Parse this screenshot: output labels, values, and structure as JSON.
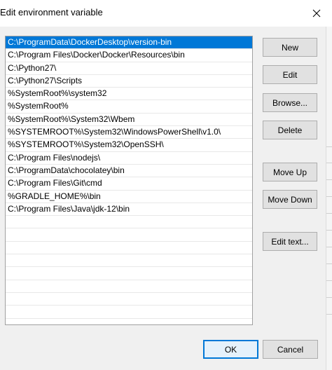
{
  "window": {
    "title": "Edit environment variable",
    "close_glyph": "✕"
  },
  "paths": [
    "C:\\ProgramData\\DockerDesktop\\version-bin",
    "C:\\Program Files\\Docker\\Docker\\Resources\\bin",
    "C:\\Python27\\",
    "C:\\Python27\\Scripts",
    "%SystemRoot%\\system32",
    "%SystemRoot%",
    "%SystemRoot%\\System32\\Wbem",
    "%SYSTEMROOT%\\System32\\WindowsPowerShell\\v1.0\\",
    "%SYSTEMROOT%\\System32\\OpenSSH\\",
    "C:\\Program Files\\nodejs\\",
    "C:\\ProgramData\\chocolatey\\bin",
    "C:\\Program Files\\Git\\cmd",
    "%GRADLE_HOME%\\bin",
    "C:\\Program Files\\Java\\jdk-12\\bin",
    "",
    "",
    "",
    "",
    "",
    "",
    "",
    ""
  ],
  "selected_index": 0,
  "buttons": {
    "new": "New",
    "edit": "Edit",
    "browse": "Browse...",
    "delete": "Delete",
    "move_up": "Move Up",
    "move_down": "Move Down",
    "edit_text": "Edit text..."
  },
  "footer": {
    "ok": "OK",
    "cancel": "Cancel"
  },
  "colors": {
    "selection": "#0078d7",
    "default_button_border": "#0078d7"
  },
  "icons": {
    "close": "close-icon"
  }
}
